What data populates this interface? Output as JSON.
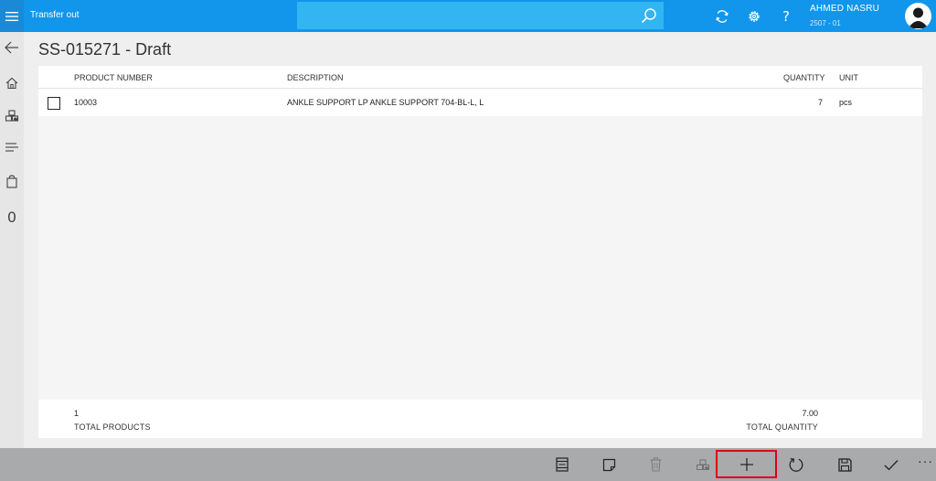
{
  "app": {
    "title": "Transfer out"
  },
  "search": {
    "placeholder": ""
  },
  "header": {
    "icons": [
      "menu-icon",
      "search-icon",
      "sync-icon",
      "settings-icon",
      "help-icon"
    ],
    "help_label": "?",
    "user": {
      "name": "AHMED NASRU",
      "branch": "2507 - 01"
    }
  },
  "rail": {
    "icons": [
      "back-arrow-icon",
      "home-icon",
      "products-icon",
      "list-icon",
      "bag-icon"
    ],
    "count": "0"
  },
  "document": {
    "title": "SS-015271 - Draft"
  },
  "table": {
    "columns": {
      "product_number": "PRODUCT NUMBER",
      "description": "DESCRIPTION",
      "quantity": "QUANTITY",
      "unit": "UNIT"
    },
    "rows": [
      {
        "product_number": "10003",
        "description": "ANKLE SUPPORT LP ANKLE SUPPORT 704-BL-L, L",
        "quantity": "7",
        "unit": "pcs",
        "checked": false
      }
    ]
  },
  "totals": {
    "products_value": "1",
    "products_label": "TOTAL PRODUCTS",
    "quantity_value": "7.00",
    "quantity_label": "TOTAL QUANTITY"
  },
  "commandbar": {
    "icons": [
      "document-icon",
      "note-icon",
      "delete-icon",
      "products-icon",
      "add-icon",
      "refresh-icon",
      "save-icon",
      "checkmark-icon",
      "more-icon"
    ],
    "more_label": "···",
    "highlighted": "add-icon",
    "highlight_color": "#e0001a"
  },
  "colors": {
    "header_bg": "#1196eb",
    "search_bg": "#33b5f2",
    "commandbar_bg": "#a8aaac"
  }
}
